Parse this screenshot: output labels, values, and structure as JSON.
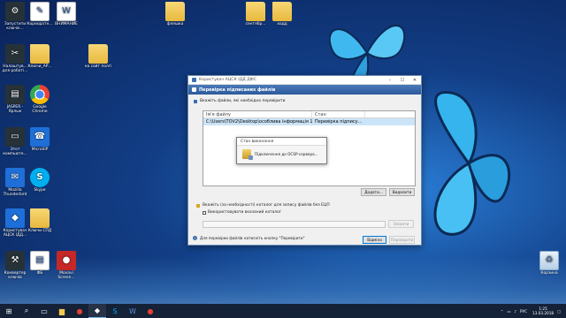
{
  "desktop": {
    "icons_left": [
      {
        "label": "Запустити ключіє...",
        "kind": "app-dark",
        "glyph": "⚙",
        "icon": "shortcut-icon"
      },
      {
        "label": "Кориоратн...",
        "kind": "doc",
        "glyph": "✎",
        "icon": "document-icon"
      },
      {
        "label": "ВНИМАНИЕ",
        "kind": "doc",
        "glyph": "W",
        "icon": "word-document-icon"
      },
      {
        "label": "Налаштув... для роботі...",
        "kind": "app-dark",
        "glyph": "✂",
        "icon": "tools-icon"
      },
      {
        "label": "Ключи_АР...",
        "kind": "folder",
        "glyph": "",
        "icon": "folder-icon"
      },
      {
        "label": "на сайт полгі",
        "kind": "folder",
        "glyph": "",
        "icon": "folder-icon"
      },
      {
        "label": "JASPER - Ярлык",
        "kind": "app-dark",
        "glyph": "▤",
        "icon": "computer-icon"
      },
      {
        "label": "Google Chrome",
        "kind": "chrome",
        "glyph": "",
        "icon": "chrome-icon"
      },
      {
        "label": "Этот компьюте...",
        "kind": "app-dark",
        "glyph": "▭",
        "icon": "this-pc-icon"
      },
      {
        "label": "MicroSIP",
        "kind": "app-blue",
        "glyph": "☎",
        "icon": "phone-icon"
      },
      {
        "label": "Mozilla Thunderbird",
        "kind": "app-blue",
        "glyph": "✉",
        "icon": "thunderbird-icon"
      },
      {
        "label": "Skype",
        "kind": "skype",
        "glyph": "S",
        "icon": "skype-icon"
      },
      {
        "label": "Користувач АЦСК ІДД...",
        "kind": "app-blue",
        "glyph": "◆",
        "icon": "user-app-icon"
      },
      {
        "label": "Ключи СПД",
        "kind": "folder",
        "glyph": "",
        "icon": "folder-icon"
      },
      {
        "label": "Конвертер ключів",
        "kind": "app-dark",
        "glyph": "⚒",
        "icon": "converter-icon"
      },
      {
        "label": "ФБ",
        "kind": "doc",
        "glyph": "▤",
        "icon": "document-icon"
      },
      {
        "label": "Movavi Screen...",
        "kind": "app-red",
        "glyph": "●",
        "icon": "movavi-icon"
      }
    ],
    "icons_top": [
      {
        "label": "флешка",
        "kind": "folder",
        "glyph": "",
        "icon": "folder-icon"
      },
      {
        "label": "сентябр...",
        "kind": "folder",
        "glyph": "",
        "icon": "folder-icon"
      },
      {
        "label": "ходд",
        "kind": "folder",
        "glyph": "",
        "icon": "folder-icon"
      }
    ],
    "recycle_bin": "Корзина"
  },
  "window": {
    "title": "Користувач АЦСК ІДД ДФС",
    "header": "Перевірка підписаних файлів",
    "select_files_label": "Вкажіть файли, які необхідно перевірити",
    "columns": [
      "Ім'я файлу",
      "Стан"
    ],
    "rows": [
      {
        "name": "C:\\Users\\TOV2\\Desktop\\особлива інформація 11.03.2...",
        "state": "Перевірка підпису..."
      }
    ],
    "add_button": "Додати...",
    "remove_button": "Видалити",
    "dir_label": "Вкажіть (за необхідності) каталог для запису файлів без ЕЦП",
    "use_dir_checkbox": "Використовувати вказаний каталог",
    "change_button": "Змінити",
    "info_text": "Для перевірки файлів натисніть кнопку \"Перевірити\"",
    "cancel_button": "Відміна",
    "verify_button": "Перевірити"
  },
  "popup": {
    "title": "Стан виконання",
    "message": "Підключення до OCSP-сервера..."
  },
  "taskbar": {
    "lang": "РУС",
    "time": "1:25",
    "date": "13.03.2018"
  }
}
